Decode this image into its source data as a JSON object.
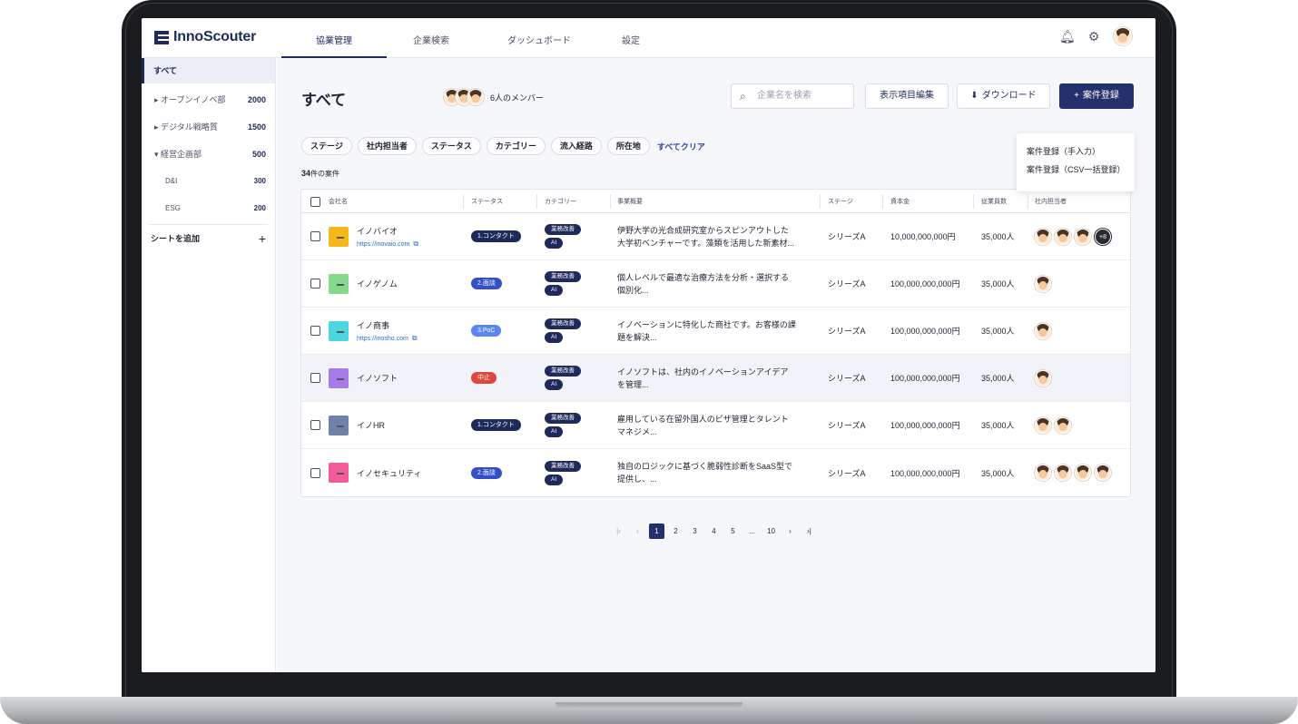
{
  "app": {
    "logo_text": "InnoScouter"
  },
  "nav": {
    "tabs": [
      {
        "label": "協業管理",
        "active": true
      },
      {
        "label": "企業検索",
        "active": false
      },
      {
        "label": "ダッシュボード",
        "active": false
      },
      {
        "label": "設定",
        "active": false
      }
    ],
    "icons": [
      "bell-icon",
      "gear-icon",
      "user-avatar"
    ]
  },
  "sidebar": {
    "all_label": "すべて",
    "items": [
      {
        "label": "▸ オープンイノベ部",
        "count": "2000"
      },
      {
        "label": "▸ デジタル戦略質",
        "count": "1500"
      },
      {
        "label": "▾ 経営企画部",
        "count": "500"
      },
      {
        "label": "D&I",
        "count": "300"
      },
      {
        "label": "ESG",
        "count": "200"
      }
    ],
    "add_sheet_label": "シートを追加",
    "add_icon": "+"
  },
  "main": {
    "title": "すべて",
    "members_label": "6人のメンバー",
    "search_placeholder": "企業名を検索",
    "edit_columns_label": "表示項目編集",
    "download_label": "ダウンロード",
    "register_label": "案件登録",
    "dropdown": [
      "案件登録（手入力）",
      "案件登録（CSV一括登録）"
    ],
    "filters": [
      "ステージ",
      "社内担当者",
      "ステータス",
      "カテゴリー",
      "流入経路",
      "所在地"
    ],
    "clear_all_label": "すべてクリア",
    "count_number": "34",
    "count_suffix": "件の案件"
  },
  "table": {
    "headers": [
      "会社名",
      "ステータス",
      "カテゴリー",
      "事業概要",
      "ステージ",
      "資本金",
      "従業員数",
      "社内担当者"
    ],
    "rows": [
      {
        "name": "イノバイオ",
        "url": "https://inovaio.com",
        "logo_color": "#f5b81a",
        "status": "1.コンタクト",
        "status_color": "#1f2a5c",
        "cat1": "業務改善",
        "cat2": "AI",
        "summary1": "伊野大学の光合成研究室からスピンアウトした",
        "summary2": "大学初ベンチャーです。藻類を活用した新素材...",
        "stage": "シリーズA",
        "capital": "10,000,000,000円",
        "employees": "35,000人",
        "owners_more": "+8"
      },
      {
        "name": "イノゲノム",
        "url": "",
        "logo_color": "#86d98a",
        "status": "2.面談",
        "status_color": "#3450c9",
        "cat1": "業務改善",
        "cat2": "AI",
        "summary1": "個人レベルで最適な治療方法を分析・選択する",
        "summary2": "個別化...",
        "stage": "シリーズA",
        "capital": "100,000,000,000円",
        "employees": "35,000人"
      },
      {
        "name": "イノ商事",
        "url": "https://inosho.com",
        "logo_color": "#4dd6e0",
        "status": "3.PoC",
        "status_color": "#5b86f0",
        "cat1": "業務改善",
        "cat2": "AI",
        "summary1": "イノベーションに特化した商社です。お客様の課",
        "summary2": "題を解決...",
        "stage": "シリーズA",
        "capital": "100,000,000,000円",
        "employees": "35,000人"
      },
      {
        "name": "イノソフト",
        "url": "",
        "logo_color": "#a67be8",
        "status": "中止",
        "status_color": "#e0453e",
        "cat1": "業務改善",
        "cat2": "AI",
        "summary1": "イノソフトは、社内のイノベーションアイデア",
        "summary2": "を管理...",
        "stage": "シリーズA",
        "capital": "100,000,000,000円",
        "employees": "35,000人"
      },
      {
        "name": "イノHR",
        "url": "",
        "logo_color": "#7081a8",
        "status": "1.コンタクト",
        "status_color": "#1f2a5c",
        "cat1": "業務改善",
        "cat2": "AI",
        "summary1": "雇用している在留外国人のビザ管理とタレント",
        "summary2": "マネジメ...",
        "stage": "シリーズA",
        "capital": "100,000,000,000円",
        "employees": "35,000人"
      },
      {
        "name": "イノセキュリティ",
        "url": "",
        "logo_color": "#f25c9b",
        "status": "2.面談",
        "status_color": "#3450c9",
        "cat1": "業務改善",
        "cat2": "AI",
        "summary1": "独自のロジックに基づく脆弱性診断をSaaS型で",
        "summary2": "提供し、...",
        "stage": "シリーズA",
        "capital": "100,000,000,000円",
        "employees": "35,000人"
      }
    ]
  },
  "pagination": {
    "first": "|‹",
    "prev": "‹",
    "pages": [
      "1",
      "2",
      "3",
      "4",
      "5",
      "...",
      "10"
    ],
    "next": "›",
    "last": "›|"
  }
}
